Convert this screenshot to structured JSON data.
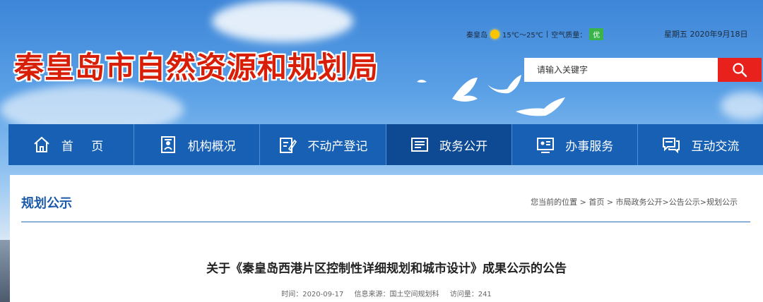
{
  "header": {
    "site_title": "秦皇岛市自然资源和规划局",
    "weather": {
      "city": "秦皇岛",
      "temperature": "15℃～25℃",
      "separator": "|",
      "air_quality_label": "空气质量：",
      "air_quality_value": "优"
    },
    "date": "星期五   2020年9月18日",
    "search": {
      "placeholder": "请输入关键字"
    }
  },
  "nav": {
    "items": [
      {
        "label": "首  页",
        "icon": "home-icon"
      },
      {
        "label": "机构概况",
        "icon": "org-icon"
      },
      {
        "label": "不动产登记",
        "icon": "register-icon"
      },
      {
        "label": "政务公开",
        "icon": "document-icon",
        "active": true
      },
      {
        "label": "办事服务",
        "icon": "service-icon"
      },
      {
        "label": "互动交流",
        "icon": "chat-icon"
      }
    ]
  },
  "section": {
    "title": "规划公示",
    "breadcrumb": "您当前的位置 > 首页 > 市局政务公开>公告公示>规划公示"
  },
  "article": {
    "title": "关于《秦皇岛西港片区控制性详细规划和城市设计》成果公示的公告",
    "time": "时间：2020-09-17",
    "source": "信息来源：国土空间规划科",
    "views": "访问量：241"
  },
  "colors": {
    "brand_red": "#d81e06",
    "nav_blue": "#1760b3",
    "nav_active": "#0d4a93",
    "aq_green": "#3ab34a"
  }
}
